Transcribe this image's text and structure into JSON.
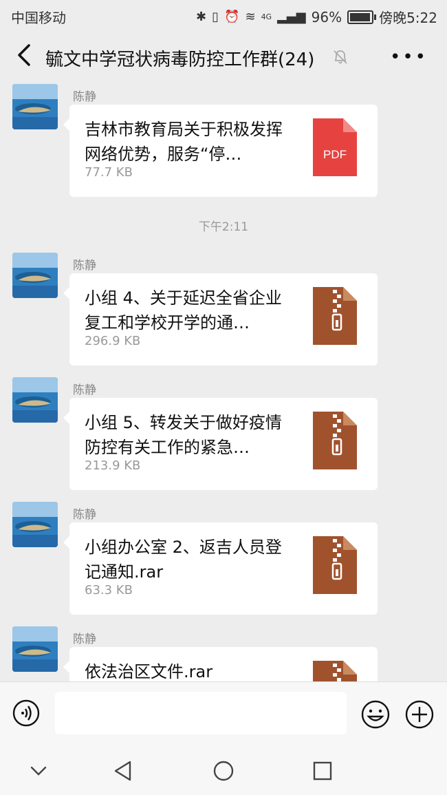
{
  "status_bar": {
    "carrier": "中国移动",
    "network": "4G",
    "battery": "96%",
    "battery_level": 0.96,
    "time": "傍晚5:22"
  },
  "header": {
    "title": "毓文中学冠状病毒防控工作群(24)"
  },
  "messages": [
    {
      "sender": "陈静",
      "file_name": "吉林市教育局关于积极发挥网络优势，服务“停…",
      "file_size": "77.7 KB",
      "file_type": "pdf",
      "file_type_label": "PDF"
    },
    {
      "sender": "陈静",
      "file_name": "小组 4、关于延迟全省企业复工和学校开学的通…",
      "file_size": "296.9 KB",
      "file_type": "archive"
    },
    {
      "sender": "陈静",
      "file_name": "小组 5、转发关于做好疫情防控有关工作的紧急…",
      "file_size": "213.9 KB",
      "file_type": "archive"
    },
    {
      "sender": "陈静",
      "file_name": "小组办公室 2、返吉人员登记通知.rar",
      "file_size": "63.3 KB",
      "file_type": "archive"
    },
    {
      "sender": "陈静",
      "file_name": "依法治区文件.rar",
      "file_size": "",
      "file_type": "archive"
    }
  ],
  "timestamp": "下午2:11",
  "colors": {
    "pdf": "#e64340",
    "archive": "#a0522d",
    "background": "#ededed"
  },
  "icons": {
    "back": "back-arrow-icon",
    "mute": "bell-off-icon",
    "more": "more-dots-icon",
    "voice": "voice-icon",
    "emoji": "emoji-icon",
    "plus": "plus-icon"
  }
}
